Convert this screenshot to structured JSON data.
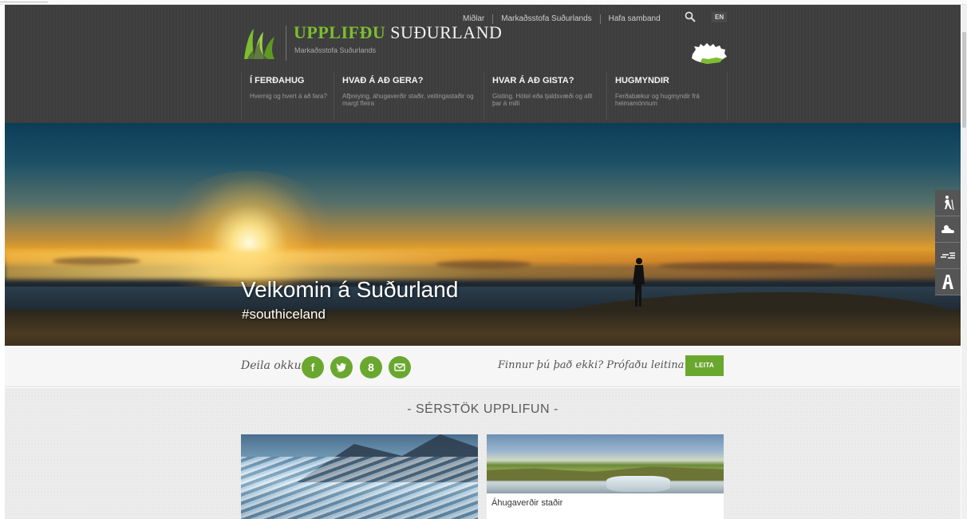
{
  "header": {
    "logo_green": "UPPLIFÐU",
    "logo_white": "SUÐURLAND",
    "logo_sub": "Markaðsstofa Suðurlands",
    "top_links": [
      "Miðlar",
      "Markaðsstofa Suðurlands",
      "Hafa samband"
    ],
    "lang": "EN"
  },
  "nav": [
    {
      "title": "Í FERÐAHUG",
      "desc": "Hvernig og hvert á að fara?"
    },
    {
      "title": "HVAÐ Á AÐ GERA?",
      "desc": "Afþreying, áhugaverðir staðir, veitingastaðir og margt fleira"
    },
    {
      "title": "HVAR Á AÐ GISTA?",
      "desc": "Gisting. Hótel eða tjaldsvæði og allt þar á milli"
    },
    {
      "title": "HUGMYNDIR",
      "desc": "Ferðabækur og hugmyndir frá heimamönnum"
    }
  ],
  "hero": {
    "title": "Velkomin á Suðurland",
    "hashtag": "#southiceland"
  },
  "side_tools": [
    "hiking-icon",
    "weather-icon",
    "wind-icon",
    "road-icon"
  ],
  "share": {
    "label": "Deila okkur",
    "networks": [
      "facebook-icon",
      "twitter-icon",
      "googleplus-icon",
      "email-icon"
    ],
    "search_hint": "Finnur þú það ekki? Prófaðu leitina :)",
    "search_button": "LEITA"
  },
  "featured": {
    "title": "- SÉRSTÖK UPPLIFUN -",
    "cards": [
      {
        "caption": ""
      },
      {
        "caption": "Áhugaverðir staðir"
      }
    ]
  },
  "colors": {
    "brand_green": "#6aa72f",
    "logo_green": "#7dbd2f",
    "header_bg": "#3e3e3e"
  }
}
